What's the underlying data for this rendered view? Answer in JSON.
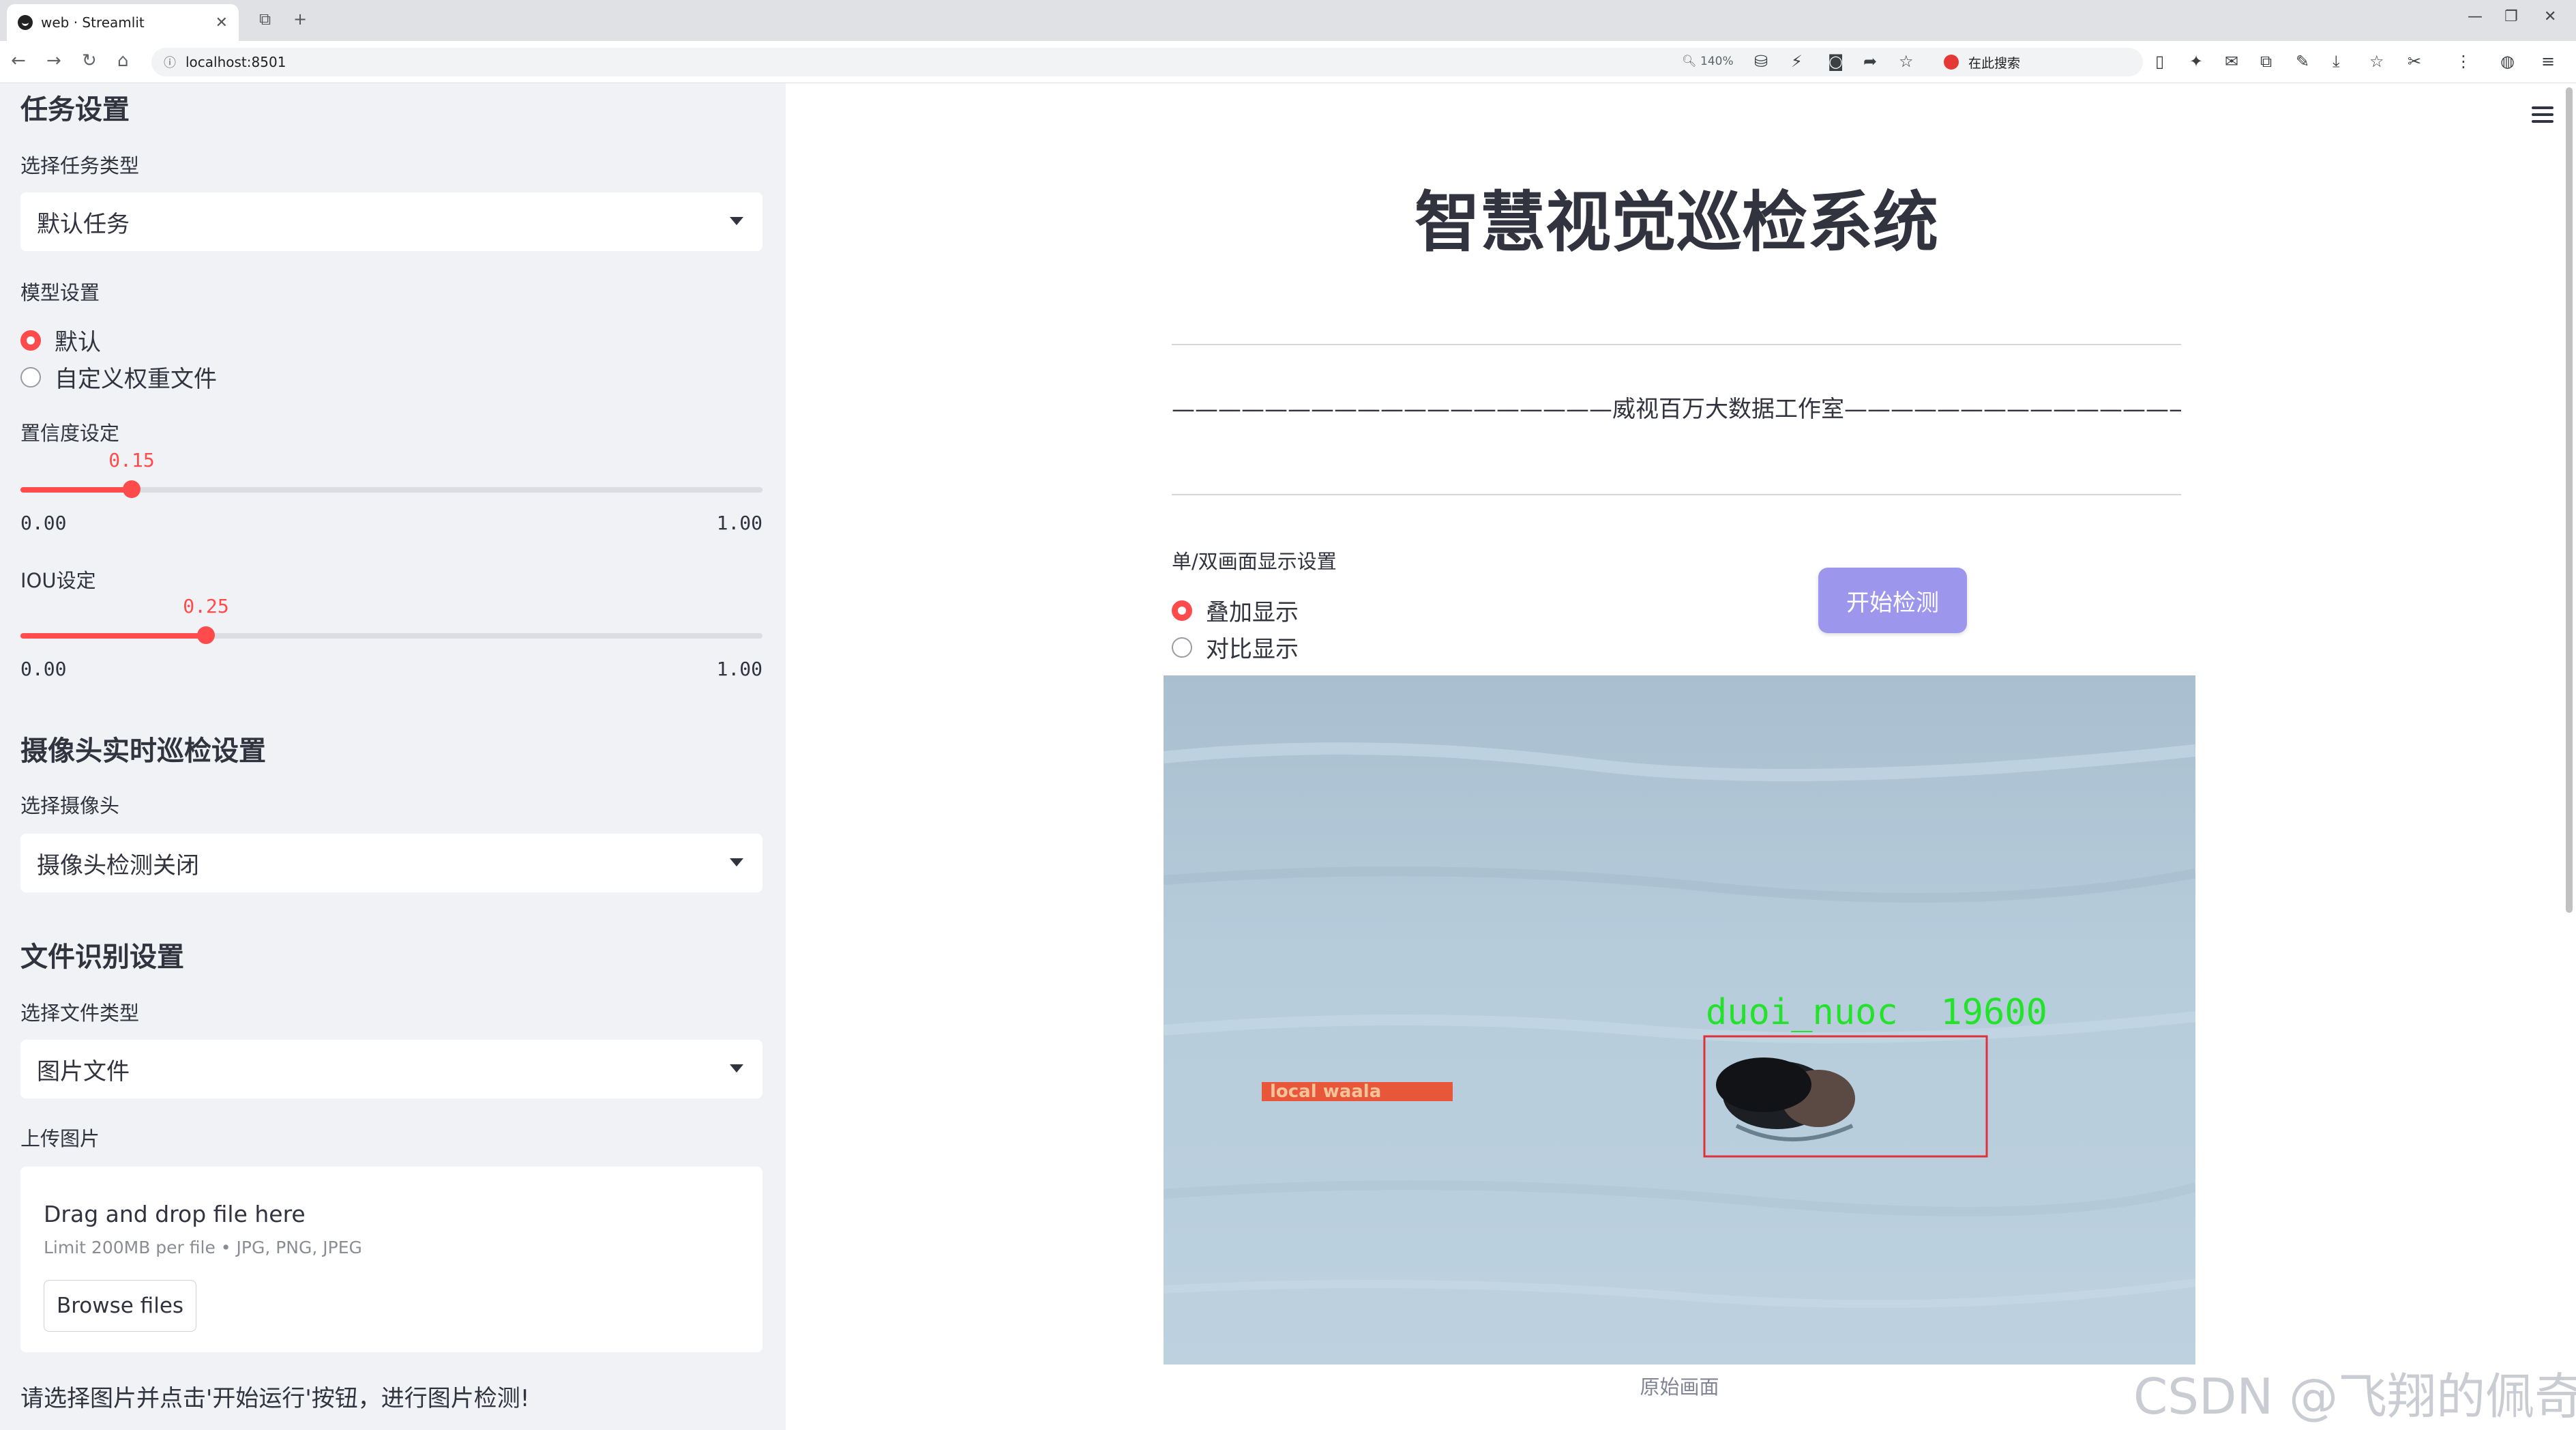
{
  "browser": {
    "tab_title": "web · Streamlit",
    "url": "localhost:8501",
    "zoom": "140%",
    "search_placeholder": "在此搜索"
  },
  "sidebar": {
    "task_heading": "任务设置",
    "task_type_label": "选择任务类型",
    "task_type_value": "默认任务",
    "model_label": "模型设置",
    "model_options": [
      "默认",
      "自定义权重文件"
    ],
    "model_selected": "默认",
    "conf_label": "置信度设定",
    "conf_value": "0.15",
    "conf_min": "0.00",
    "conf_max": "1.00",
    "iou_label": "IOU设定",
    "iou_value": "0.25",
    "iou_min": "0.00",
    "iou_max": "1.00",
    "camera_heading": "摄像头实时巡检设置",
    "camera_label": "选择摄像头",
    "camera_value": "摄像头检测关闭",
    "file_heading": "文件识别设置",
    "file_type_label": "选择文件类型",
    "file_type_value": "图片文件",
    "upload_label": "上传图片",
    "drop_text": "Drag and drop file here",
    "limit_text": "Limit 200MB per file • JPG, PNG, JPEG",
    "browse_label": "Browse files",
    "hint": "请选择图片并点击'开始运行'按钮，进行图片检测!"
  },
  "main": {
    "title": "智慧视觉巡检系统",
    "banner": "———————————————————威视百万大数据工作室———————————————————",
    "display_label": "单/双画面显示设置",
    "display_options": [
      "叠加显示",
      "对比显示"
    ],
    "display_selected": "叠加显示",
    "start_button": "开始检测",
    "image_caption": "原始画面",
    "detection_label": "duoi_nuoc  19600",
    "overlay_text": "local waala",
    "watermark": "CSDN @飞翔的佩奇"
  },
  "colors": {
    "accent": "#ff4b4b",
    "button": "#9c97ec",
    "sidebar_bg": "#f0f2f6",
    "detection_box": "#e0303c",
    "detection_text": "#22e22a"
  }
}
